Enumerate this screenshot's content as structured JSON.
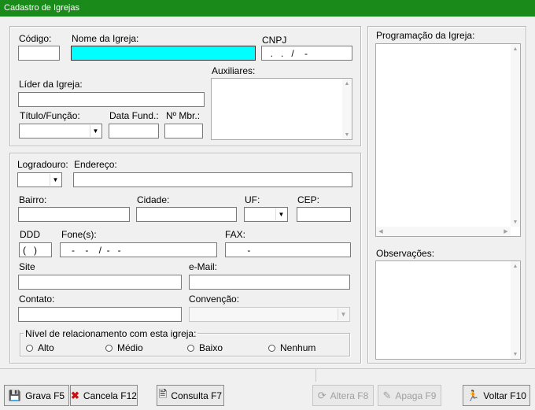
{
  "window": {
    "title": "Cadastro de Igrejas"
  },
  "colors": {
    "titlebar": "#1a8a1a",
    "focused_field": "#00ffff"
  },
  "church": {
    "codigo_label": "Código:",
    "codigo_value": "",
    "nome_label": "Nome da Igreja:",
    "nome_value": "",
    "cnpj_label": "CNPJ",
    "cnpj_mask": "  .   .   /    -",
    "lider_label": "Líder da Igreja:",
    "lider_value": "",
    "auxiliares_label": "Auxiliares:",
    "titulo_label": "Título/Função:",
    "titulo_value": "",
    "data_fund_label": "Data Fund.:",
    "data_fund_value": "",
    "nmbr_label": "Nº Mbr.:",
    "nmbr_value": ""
  },
  "address": {
    "logradouro_label": "Logradouro:",
    "logradouro_value": "",
    "endereco_label": "Endereço:",
    "endereco_value": "",
    "bairro_label": "Bairro:",
    "bairro_value": "",
    "cidade_label": "Cidade:",
    "cidade_value": "",
    "uf_label": "UF:",
    "uf_value": "",
    "cep_label": "CEP:",
    "cep_value": "",
    "ddd_label": "DDD",
    "ddd_mask": "(   )",
    "fones_label": "Fone(s):",
    "fones_mask": "   -    -    /  -   -",
    "fax_label": "FAX:",
    "fax_mask": "       -",
    "site_label": "Site",
    "site_value": "",
    "email_label": "e-Mail:",
    "email_value": "",
    "contato_label": "Contato:",
    "contato_value": "",
    "convencao_label": "Convenção:",
    "convencao_value": ""
  },
  "relationship": {
    "label": "Nível de relacionamento com esta igreja:",
    "options": [
      "Alto",
      "Médio",
      "Baixo",
      "Nenhum"
    ]
  },
  "side": {
    "programacao_label": "Programação da Igreja:",
    "observacoes_label": "Observações:"
  },
  "buttons": {
    "grava": "Grava F5",
    "cancela": "Cancela F12",
    "consulta": "Consulta F7",
    "altera": "Altera F8",
    "apaga": "Apaga F9",
    "voltar": "Voltar F10"
  }
}
